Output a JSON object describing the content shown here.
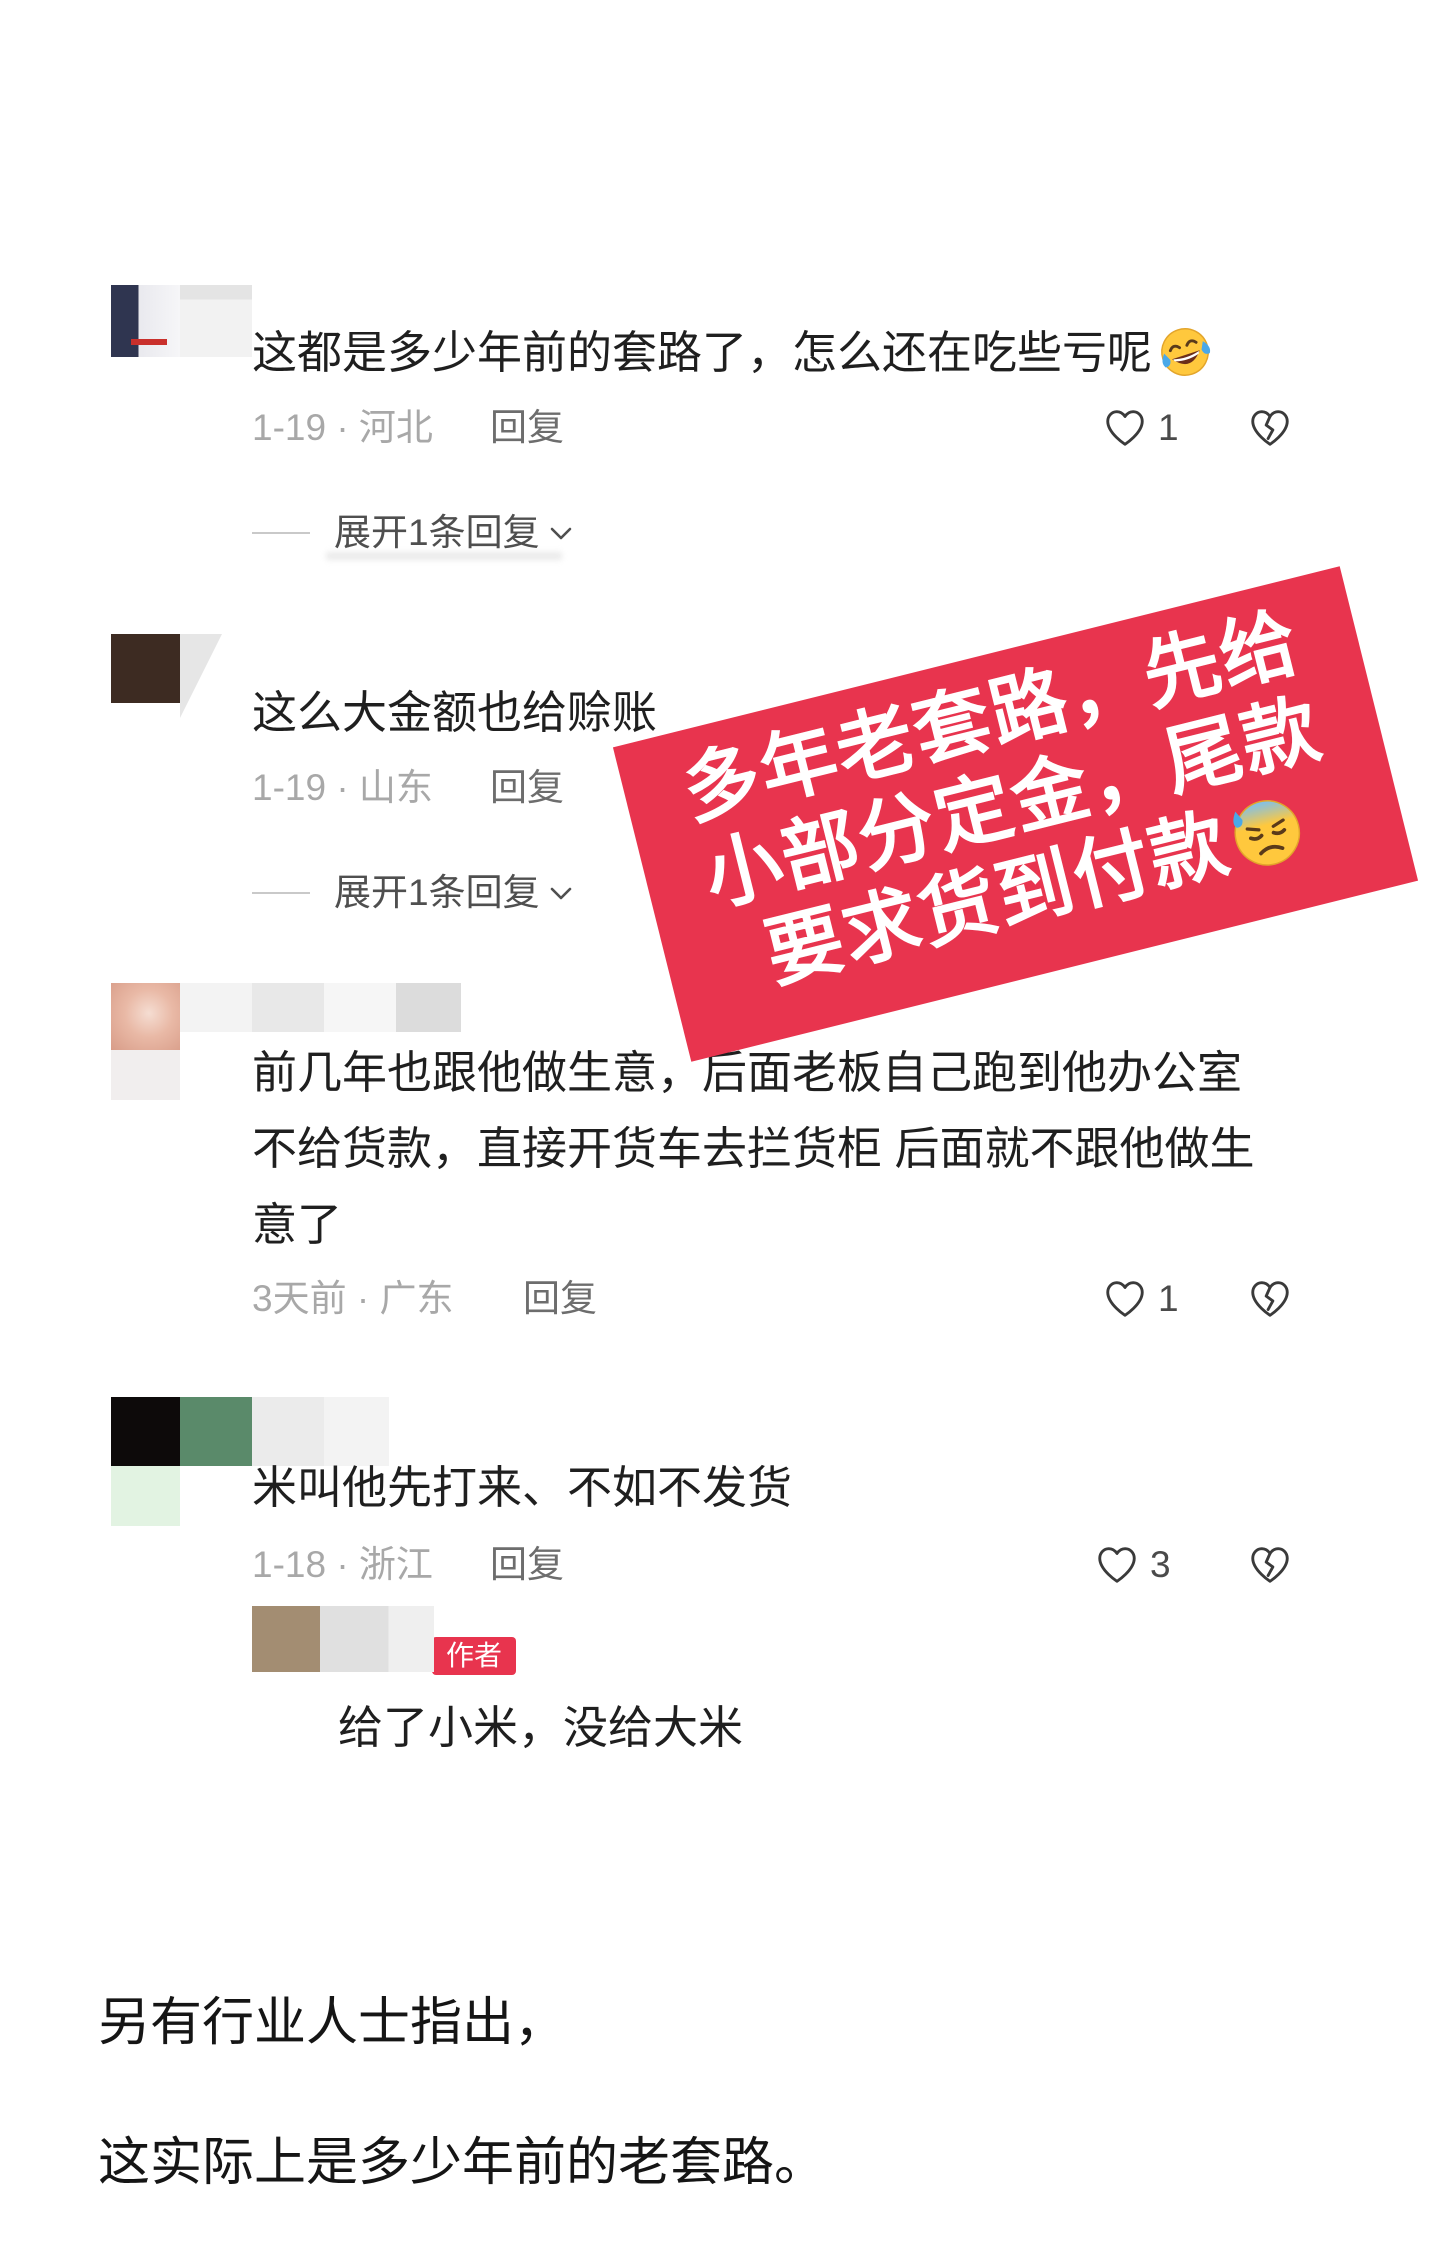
{
  "comments": [
    {
      "text": "这都是多少年前的套路了，怎么还在吃些亏呢",
      "emoji": "laughing-tears-emoji-icon",
      "date_location": "1-19 · 河北",
      "reply_label": "回复",
      "likes": "1",
      "expand_label": "展开1条回复"
    },
    {
      "text": "这么大金额也给赊账",
      "date_location": "1-19 · 山东",
      "reply_label": "回复",
      "expand_label": "展开1条回复"
    },
    {
      "text_lines": [
        "前几年也跟他做生意，后面老板自己跑到他办公室",
        "不给货款，直接开货车去拦货柜 后面就不跟他做生",
        "意了"
      ],
      "date_location": "3天前 · 广东",
      "reply_label": "回复",
      "likes": "1"
    },
    {
      "text": "米叫他先打来、不如不发货",
      "date_location": "1-18 · 浙江",
      "reply_label": "回复",
      "likes": "3",
      "author_reply": {
        "badge": "作者",
        "text": "给了小米，没给大米"
      }
    }
  ],
  "banner": {
    "lines": [
      "多年老套路，先给",
      "小部分定金，尾款",
      "要求货到付款"
    ],
    "emoji": "downcast-sweat-emoji-icon",
    "background": "#e8344e",
    "text_color": "#ffffff"
  },
  "article": {
    "paragraphs": [
      "另有行业人士指出，",
      "这实际上是多少年前的老套路。"
    ]
  },
  "icons": {
    "like": "heart-outline-icon",
    "dislike": "broken-heart-icon",
    "expand": "chevron-down-icon"
  },
  "colors": {
    "comment_text": "#1f1f1f",
    "meta_text": "#a8a8a8",
    "author_badge": "#e8344e"
  }
}
